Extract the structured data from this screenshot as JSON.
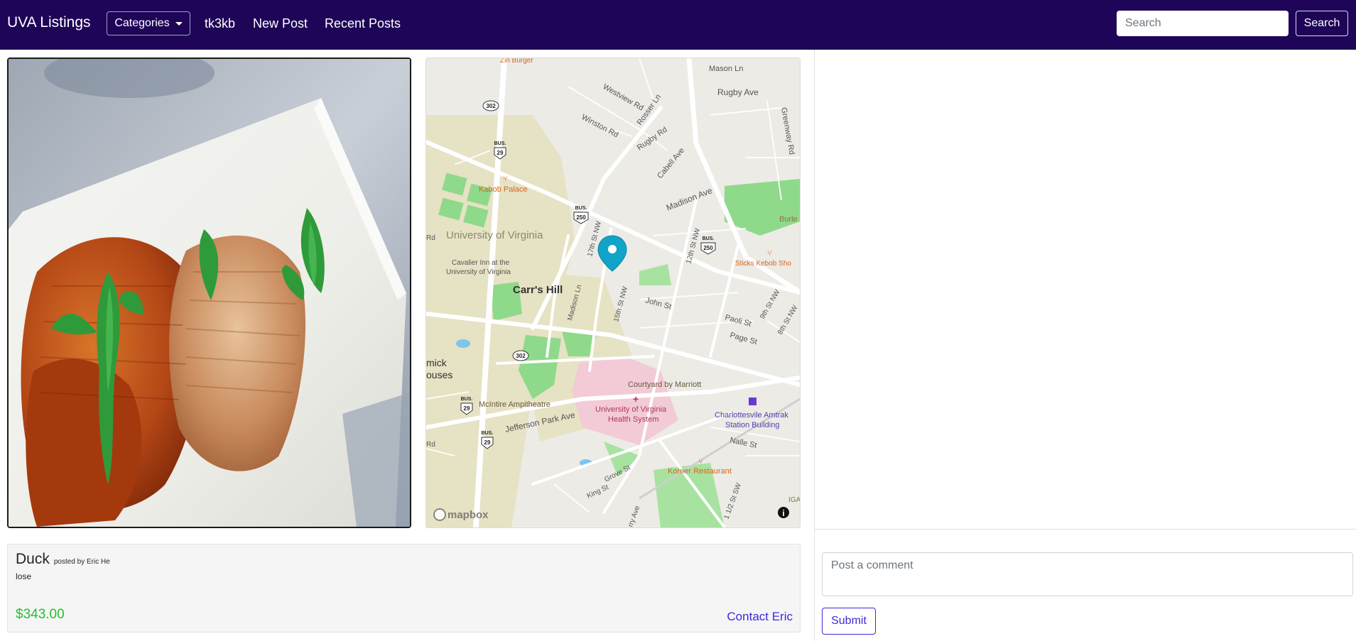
{
  "navbar": {
    "brand": "UVA Listings",
    "categories_label": "Categories",
    "links": [
      "tk3kb",
      "New Post",
      "Recent Posts"
    ],
    "search_placeholder": "Search",
    "search_button": "Search",
    "background_color": "#1e0557"
  },
  "listing": {
    "title": "Duck",
    "posted_by": "posted by Eric He",
    "description": "lose",
    "price": "$343.00",
    "contact_label": "Contact Eric",
    "price_color": "#22c02a"
  },
  "map": {
    "attribution": "mapbox",
    "info_icon": "i",
    "marker_icon": "map-pin-icon",
    "marker_color": "#11a4c9",
    "labels": {
      "zin_burger": "Zin Burger",
      "mason_ln": "Mason Ln",
      "rugby_ave": "Rugby Ave",
      "westview_rd": "Westview Rd",
      "rosser_ln": "Rosser Ln",
      "winston_rd": "Winston Rd",
      "rugby_rd": "Rugby Rd",
      "cabell_ave": "Cabell Ave",
      "greenway_rd": "Greenway Rd",
      "madison_ave": "Madison Ave",
      "kabob_palace": "Kabob Palace",
      "university": "University of Virginia",
      "st_17th": "17th St NW",
      "st_12th": "12th St NW",
      "burley": "Burle",
      "sticks": "Sticks Kebob Sho",
      "cavalier_1": "Cavalier Inn at the",
      "cavalier_2": "University of Virginia",
      "carrs_hill": "Carr's Hill",
      "madison_ln": "Madison Ln",
      "st_15th": "15th St NW",
      "john_st": "John St",
      "paoli_st": "Paoli St",
      "st_9th": "9th St NW",
      "st_8th": "8th St NW",
      "page_st": "Page St",
      "mcormick_1": "mick",
      "mcormick_2": "ouses",
      "courtyard": "Courtyard by Marriott",
      "mcintire": "McIntire Ampitheatre",
      "uva_health_1": "University of Virginia",
      "uva_health_2": "Health System",
      "amtrak_1": "Charlottesvile Amtrak",
      "amtrak_2": "Station Building",
      "jefferson_park": "Jefferson Park Ave",
      "nalle_st": "Nalle St",
      "grove_st": "Grove St",
      "korner": "Korner Restaurant",
      "king_st": "King St",
      "cherry_ave": "rry Ave",
      "st_11half": "1 1/2 St SW",
      "rd_left_1": "Rd",
      "rd_left_2": "Rd",
      "iga": "IGA",
      "shield_302": "302",
      "shield_29": "29",
      "shield_250": "250",
      "bus": "BUS."
    }
  },
  "comment": {
    "placeholder": "Post a comment",
    "submit_label": "Submit"
  }
}
